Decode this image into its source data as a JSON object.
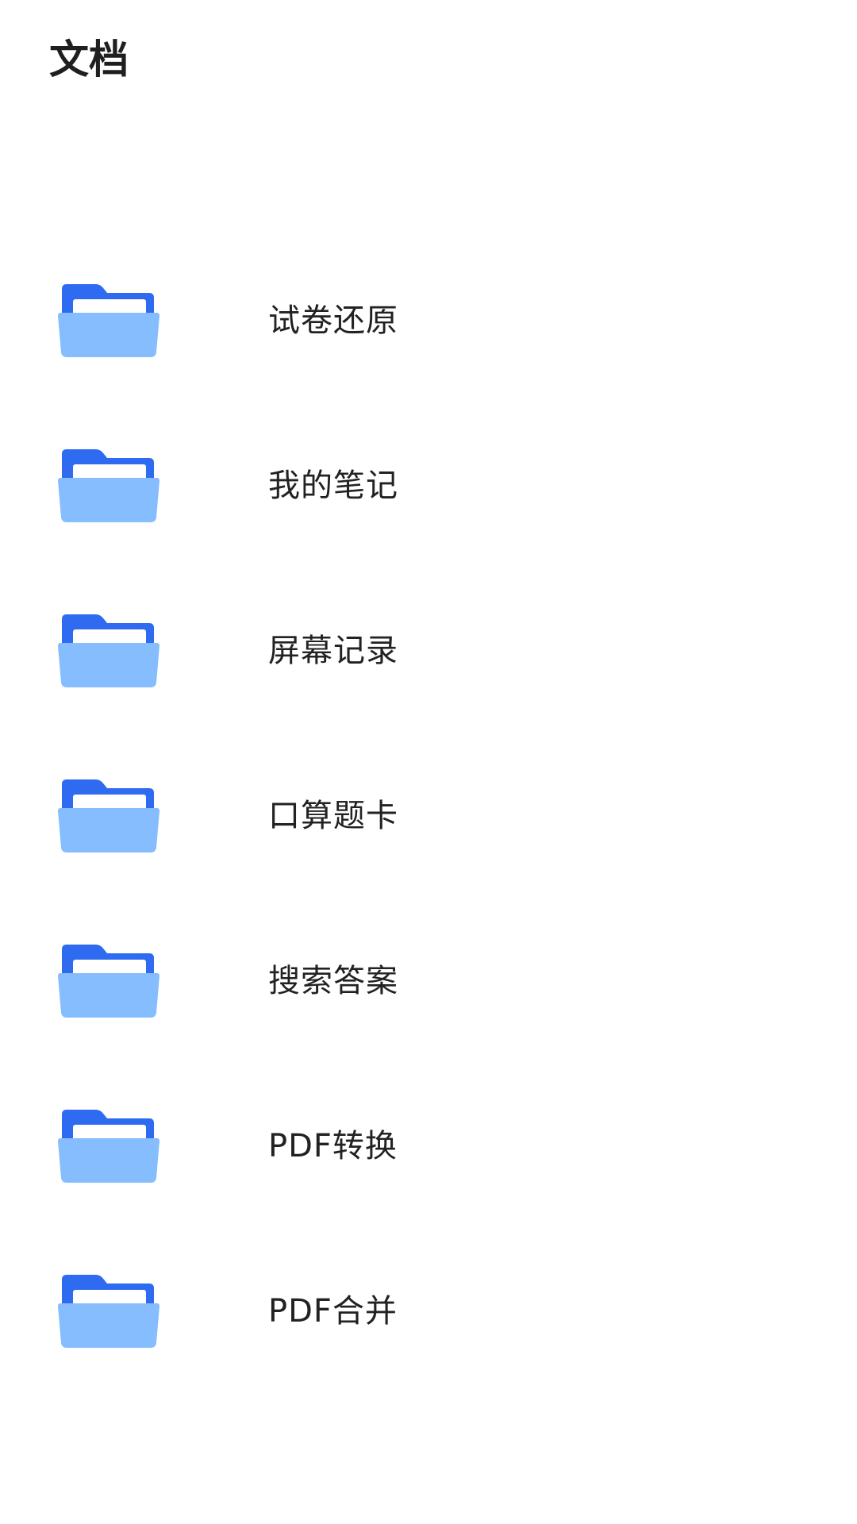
{
  "header": {
    "title": "文档"
  },
  "colors": {
    "folder_back": "#2F6BF0",
    "folder_paper": "#FFFFFF",
    "folder_front": "#86BDFE"
  },
  "folders": [
    {
      "label": "试卷还原",
      "icon": "folder-icon"
    },
    {
      "label": "我的笔记",
      "icon": "folder-icon"
    },
    {
      "label": "屏幕记录",
      "icon": "folder-icon"
    },
    {
      "label": "口算题卡",
      "icon": "folder-icon"
    },
    {
      "label": "搜索答案",
      "icon": "folder-icon"
    },
    {
      "label": "PDF转换",
      "icon": "folder-icon"
    },
    {
      "label": "PDF合并",
      "icon": "folder-icon"
    }
  ]
}
